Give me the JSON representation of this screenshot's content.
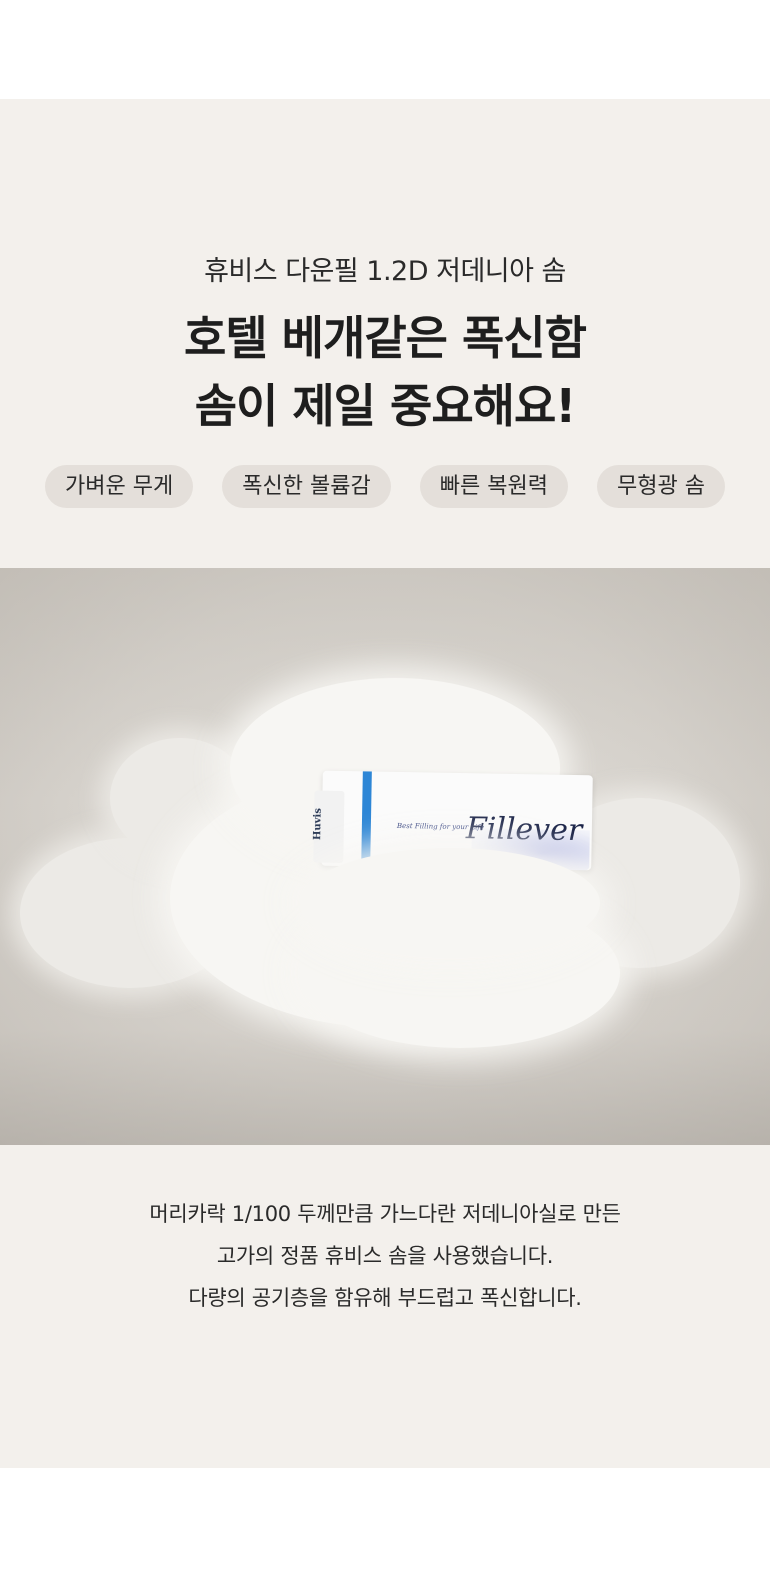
{
  "intro": {
    "subtitle": "휴비스 다운필 1.2D 저데니아 솜",
    "headline_lines": [
      "호텔 베개같은 폭신함",
      "솜이 제일 중요해요!"
    ],
    "tags": [
      "가벼운 무게",
      "폭신한 볼륨감",
      "빠른 복원력",
      "무형광 솜"
    ]
  },
  "photo": {
    "card": {
      "brand": "Huvis",
      "tagline": "Best Filling for your Life",
      "logo": "Fillever"
    }
  },
  "description": {
    "lines": [
      "머리카락 1/100 두께만큼 가느다란 저데니아실로 만든",
      "고가의 정품 휴비스 솜을 사용했습니다.",
      "다량의 공기층을 함유해 부드럽고 폭신합니다."
    ]
  },
  "colors": {
    "panel_bg": "#f3f0ec",
    "tag_bg": "#e4dfda",
    "card_stripe": "#2d86d6"
  }
}
